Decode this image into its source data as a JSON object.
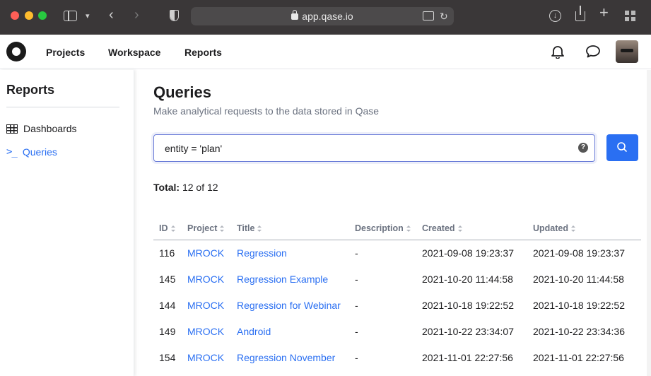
{
  "browser": {
    "url": "app.qase.io"
  },
  "header": {
    "nav": [
      "Projects",
      "Workspace",
      "Reports"
    ]
  },
  "sidebar": {
    "title": "Reports",
    "items": [
      {
        "label": "Dashboards",
        "icon": "table-grid-icon",
        "active": false
      },
      {
        "label": "Queries",
        "icon": "terminal-icon",
        "active": true
      }
    ]
  },
  "main": {
    "title": "Queries",
    "subtitle": "Make analytical requests to the data stored in Qase",
    "query_value": "entity = 'plan'",
    "total_label": "Total:",
    "total_value": "12 of 12",
    "columns": [
      "ID",
      "Project",
      "Title",
      "Description",
      "Created",
      "Updated"
    ],
    "rows": [
      {
        "id": "116",
        "project": "MROCK",
        "title": "Regression",
        "description": "-",
        "created": "2021-09-08 19:23:37",
        "updated": "2021-09-08 19:23:37"
      },
      {
        "id": "145",
        "project": "MROCK",
        "title": "Regression Example",
        "description": "-",
        "created": "2021-10-20 11:44:58",
        "updated": "2021-10-20 11:44:58"
      },
      {
        "id": "144",
        "project": "MROCK",
        "title": "Regression for Webinar",
        "description": "-",
        "created": "2021-10-18 19:22:52",
        "updated": "2021-10-18 19:22:52"
      },
      {
        "id": "149",
        "project": "MROCK",
        "title": "Android",
        "description": "-",
        "created": "2021-10-22 23:34:07",
        "updated": "2021-10-22 23:34:36"
      },
      {
        "id": "154",
        "project": "MROCK",
        "title": "Regression November",
        "description": "-",
        "created": "2021-11-01 22:27:56",
        "updated": "2021-11-01 22:27:56"
      }
    ]
  },
  "colors": {
    "accent": "#2a6ff2",
    "chrome": "#3a3738"
  }
}
